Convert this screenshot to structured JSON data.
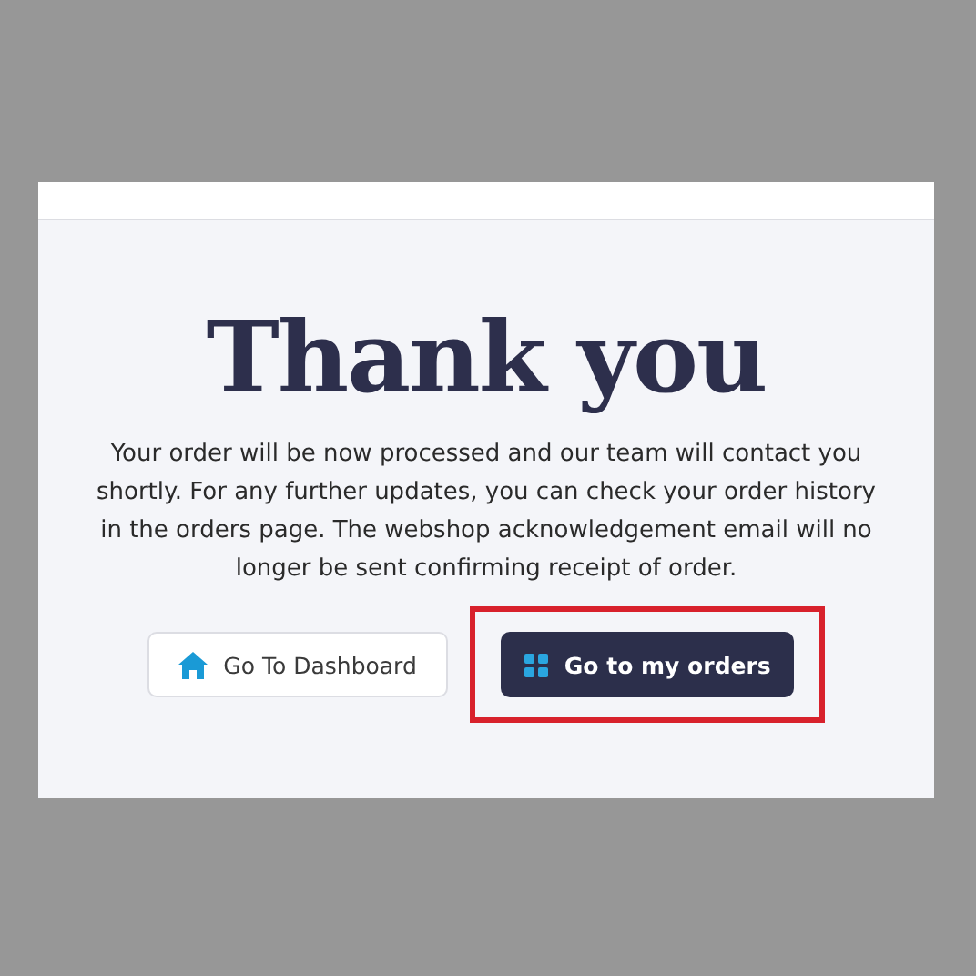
{
  "title": "Thank you",
  "message": "Your order will be now processed and our team will contact you shortly. For any further updates, you can check your order history in the orders page. The webshop acknowledgement email will no longer be sent confirming receipt of order.",
  "buttons": [
    {
      "label": "Go To Dashboard",
      "kind": "secondary",
      "highlighted": false
    },
    {
      "label": "Go to my orders",
      "kind": "primary",
      "highlighted": true
    }
  ]
}
